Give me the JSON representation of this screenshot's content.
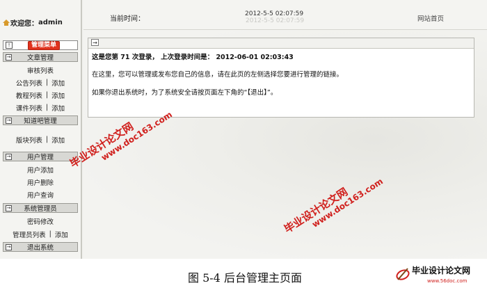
{
  "sidebar": {
    "welcome_label": "欢迎您：",
    "user": "admin",
    "menu_title": "管理菜单",
    "sections": [
      {
        "title": "文章管理",
        "rows": [
          [
            "审核列表"
          ],
          [
            "公告列表",
            "添加"
          ],
          [
            "教程列表",
            "添加"
          ],
          [
            "课件列表",
            "添加"
          ]
        ]
      },
      {
        "title": "知道吧管理",
        "rows": [
          [
            "版块列表",
            "添加"
          ]
        ]
      },
      {
        "title": "用户管理",
        "rows": [
          [
            "用户添加"
          ],
          [
            "用户删除"
          ],
          [
            "用户查询"
          ]
        ]
      },
      {
        "title": "系统管理员",
        "rows": [
          [
            "密码修改"
          ],
          [
            "管理员列表",
            "添加"
          ]
        ]
      },
      {
        "title": "退出系统",
        "rows": []
      }
    ]
  },
  "topbar": {
    "time_label": "当前时间：",
    "time_value": "2012-5-5 02:07:59",
    "site_home": "网站首页"
  },
  "panel": {
    "line1": "这是您第 71 次登录， 上次登录时间是： 2012-06-01 02:03:43",
    "line2": "在这里，您可以管理或发布您自己的信息，请在此页的左侧选择您要进行管理的链接。",
    "line3": "如果你退出系统时，为了系统安全请按页面左下角的“【退出】”。"
  },
  "watermarks": {
    "site": "毕业设计论文网",
    "url": "www.doc163.com"
  },
  "caption": "图 5-4  后台管理主页面",
  "logo": {
    "name": "毕业设计论文网",
    "url": "www.56doc.com"
  },
  "colors": {
    "badge": "#e0331e",
    "watermark": "#d0201d",
    "section_bg": "#d8d8d4"
  }
}
